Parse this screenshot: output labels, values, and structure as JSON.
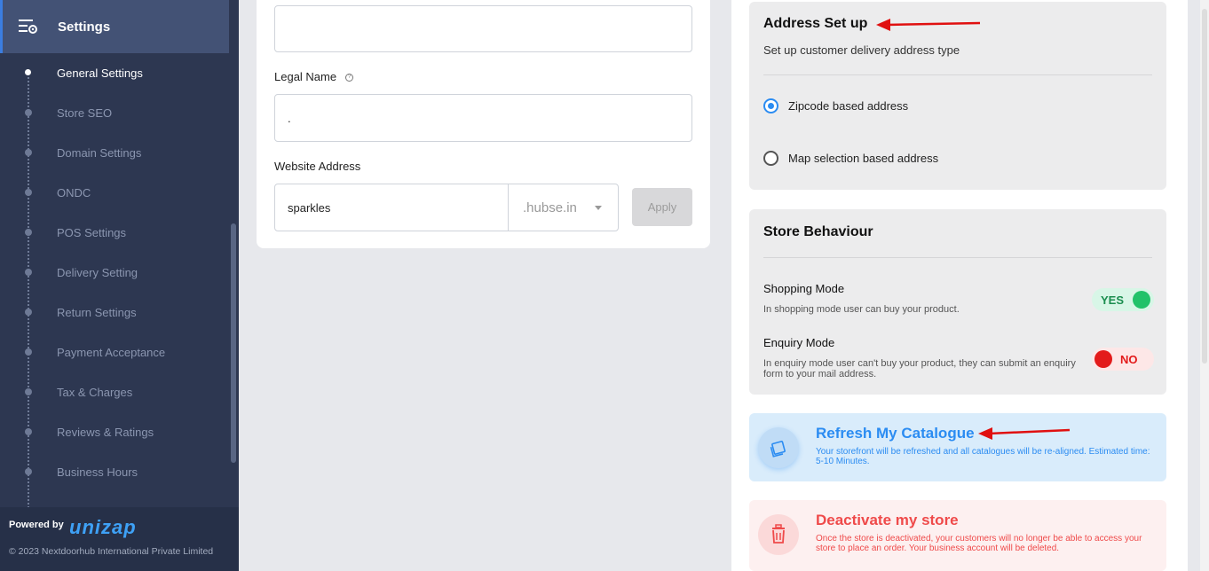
{
  "sidebar": {
    "title": "Settings",
    "items": [
      {
        "label": "General Settings",
        "active": true
      },
      {
        "label": "Store SEO"
      },
      {
        "label": "Domain Settings"
      },
      {
        "label": "ONDC"
      },
      {
        "label": "POS Settings"
      },
      {
        "label": "Delivery Setting"
      },
      {
        "label": "Return Settings"
      },
      {
        "label": "Payment Acceptance"
      },
      {
        "label": "Tax & Charges"
      },
      {
        "label": "Reviews & Ratings"
      },
      {
        "label": "Business Hours"
      }
    ],
    "footer": {
      "powered_by": "Powered by",
      "brand": "unizap",
      "copyright": "© 2023 Nextdoorhub International Private Limited"
    }
  },
  "form": {
    "top_input_value": "",
    "legal_name_label": "Legal Name",
    "legal_name_value": ".",
    "website_label": "Website Address",
    "website_value": "sparkles",
    "domain_suffix": ".hubse.in",
    "apply_label": "Apply"
  },
  "address": {
    "title": "Address Set up",
    "subtitle": "Set up customer delivery address type",
    "options": [
      {
        "label": "Zipcode based address",
        "selected": true
      },
      {
        "label": "Map selection based address",
        "selected": false
      }
    ]
  },
  "behaviour": {
    "title": "Store Behaviour",
    "shopping": {
      "title": "Shopping Mode",
      "desc": "In shopping mode user can buy your product.",
      "state": "YES"
    },
    "enquiry": {
      "title": "Enquiry Mode",
      "desc": "In enquiry mode user can't buy your product, they can submit an enquiry form to your mail address.",
      "state": "NO"
    }
  },
  "refresh": {
    "title": "Refresh My Catalogue",
    "desc": "Your storefront will be refreshed and all catalogues will be re-aligned. Estimated time: 5-10 Minutes."
  },
  "deactivate": {
    "title": "Deactivate my store",
    "desc": "Once the store is deactivated, your customers will no longer be able to access your store to place an order. Your business account will be deleted."
  },
  "colors": {
    "sidebar_bg": "#2d3751",
    "accent_blue": "#2b8cf2",
    "yes_green": "#22c26a",
    "no_red": "#e31b1b",
    "arrow_red": "#e01010"
  }
}
